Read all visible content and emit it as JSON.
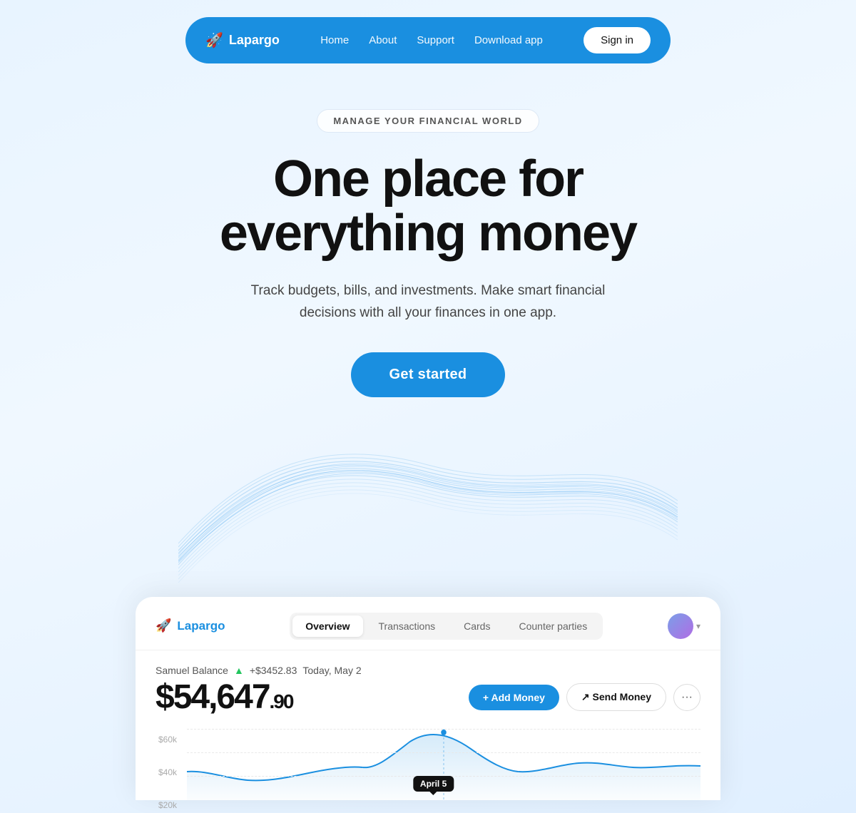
{
  "navbar": {
    "logo_text": "Lapargo",
    "logo_icon": "🚀",
    "links": [
      {
        "label": "Home",
        "id": "home"
      },
      {
        "label": "About",
        "id": "about"
      },
      {
        "label": "Support",
        "id": "support"
      },
      {
        "label": "Download app",
        "id": "download"
      }
    ],
    "signin_label": "Sign in"
  },
  "hero": {
    "badge": "MANAGE YOUR FINANCIAL WORLD",
    "title_line1": "One place for",
    "title_line2": "everything money",
    "subtitle": "Track budgets, bills, and investments. Make smart financial decisions with all your finances in one app.",
    "cta_label": "Get started"
  },
  "dashboard": {
    "logo_text": "Lapargo",
    "logo_icon": "🚀",
    "tabs": [
      {
        "label": "Overview",
        "active": true
      },
      {
        "label": "Transactions",
        "active": false
      },
      {
        "label": "Cards",
        "active": false
      },
      {
        "label": "Counter parties",
        "active": false
      }
    ],
    "balance_user": "Samuel Balance",
    "balance_change": "+$3452.83",
    "balance_date": "Today, May 2",
    "balance_main": "$54,647",
    "balance_cents": ".90",
    "chart_labels": [
      "$60k",
      "$40k",
      "$20k"
    ],
    "chart_tooltip": "April 5",
    "btn_add": "+ Add Money",
    "btn_send": "↗ Send Money",
    "btn_more": "···"
  },
  "colors": {
    "primary": "#1a8fe0",
    "bg_gradient_start": "#e8f4ff",
    "bg_gradient_end": "#e0efff"
  }
}
